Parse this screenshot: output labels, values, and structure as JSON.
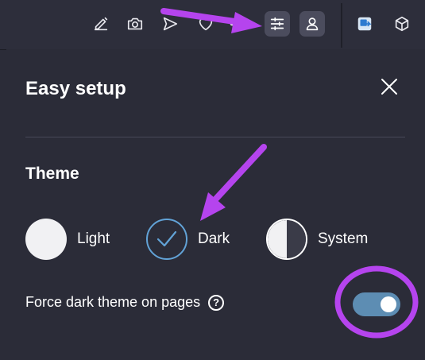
{
  "toolbar": {
    "icons": [
      "edit-icon",
      "camera-icon",
      "send-icon",
      "heart-icon",
      "more-icon",
      "easy-setup-icon",
      "profile-icon",
      "translate-extension-icon",
      "cube-extension-icon"
    ]
  },
  "panel": {
    "title": "Easy setup",
    "close_icon": "close-icon",
    "theme": {
      "heading": "Theme",
      "options": [
        {
          "label": "Light",
          "selected": false
        },
        {
          "label": "Dark",
          "selected": true
        },
        {
          "label": "System",
          "selected": false
        }
      ]
    },
    "force_dark": {
      "label": "Force dark theme on pages",
      "help_glyph": "?",
      "enabled": true
    }
  },
  "colors": {
    "background": "#2b2c38",
    "accent": "#62a3d7",
    "toggle_on": "#5d8db3",
    "annotation": "#b544ee"
  }
}
